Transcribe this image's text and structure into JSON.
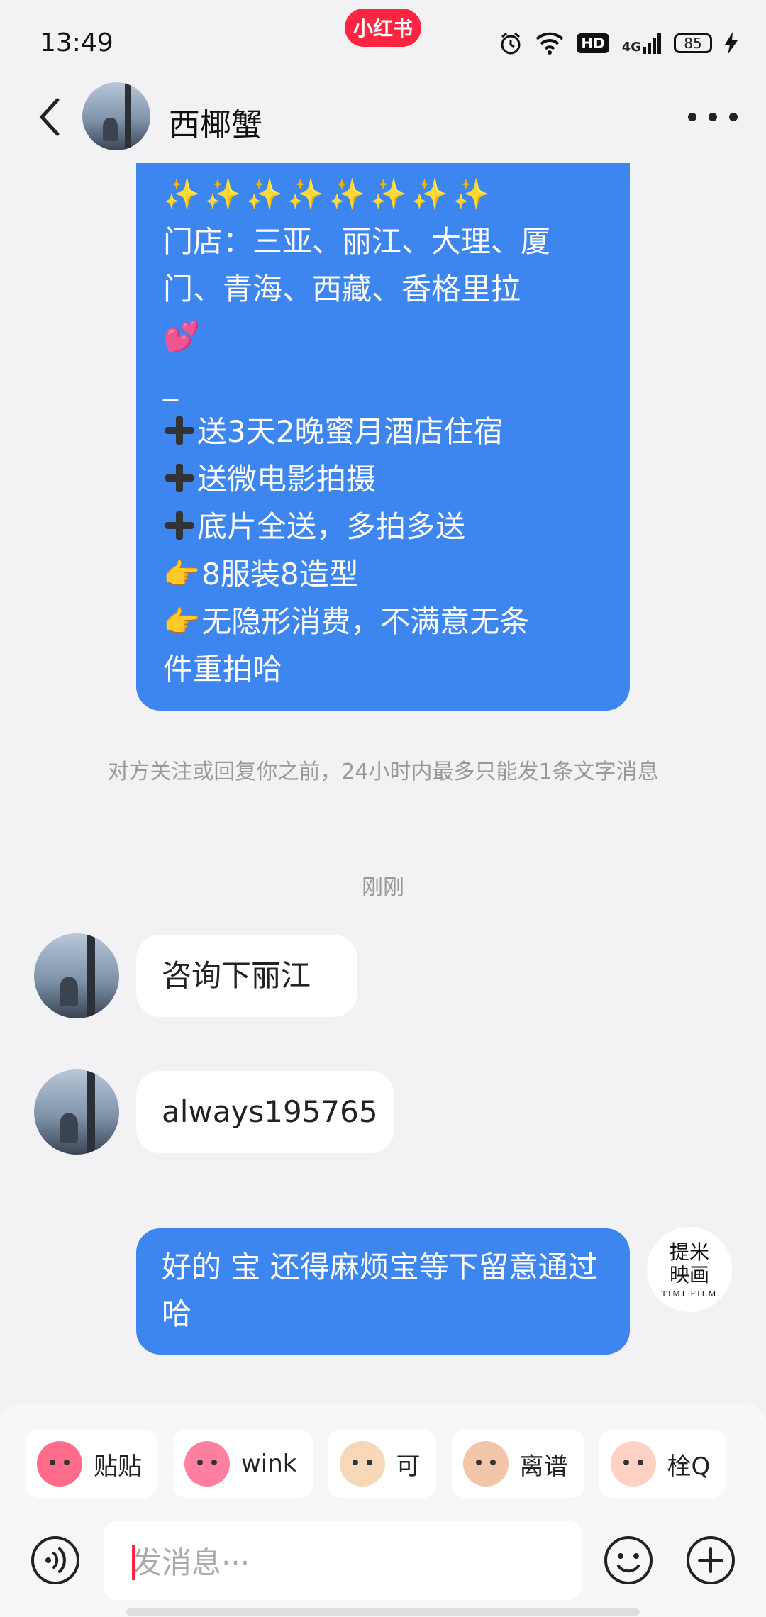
{
  "status_bar": {
    "time": "13:49",
    "brand": "小红书",
    "hd": "HD",
    "network": "4G",
    "battery": "85"
  },
  "header": {
    "title": "西椰蟹"
  },
  "long_message": {
    "sparkles": "✨✨✨✨✨✨✨✨",
    "lines": [
      "门店：三亚、丽江、大理、厦",
      "门、青海、西藏、香格里拉",
      "💕",
      "_",
      "送3天2晚蜜月酒店住宿",
      "送微电影拍摄",
      "底片全送，多拍多送",
      "8服装8造型",
      "无隐形消费，不满意无条",
      "件重拍哈"
    ],
    "point_emoji": "👉"
  },
  "system_note": "对方关注或回复你之前，24小时内最多只能发1条文字消息",
  "timestamp": "刚刚",
  "messages": [
    {
      "text": "咨询下丽江"
    },
    {
      "text": "always195765"
    },
    {
      "text": "好的  宝 还得麻烦宝等下留意通过哈"
    }
  ],
  "shop_avatar": {
    "line1": "提米",
    "line2": "映画",
    "line3": "TIMI FILM"
  },
  "stickers": [
    {
      "label": "贴贴",
      "color": "#ff6b8a"
    },
    {
      "label": "wink",
      "color": "#ff7fa0"
    },
    {
      "label": "可",
      "color": "#f6d7b8"
    },
    {
      "label": "离谱",
      "color": "#f2c4a8"
    },
    {
      "label": "栓Q",
      "color": "#ffd0c4"
    }
  ],
  "input": {
    "placeholder": "发消息···"
  }
}
